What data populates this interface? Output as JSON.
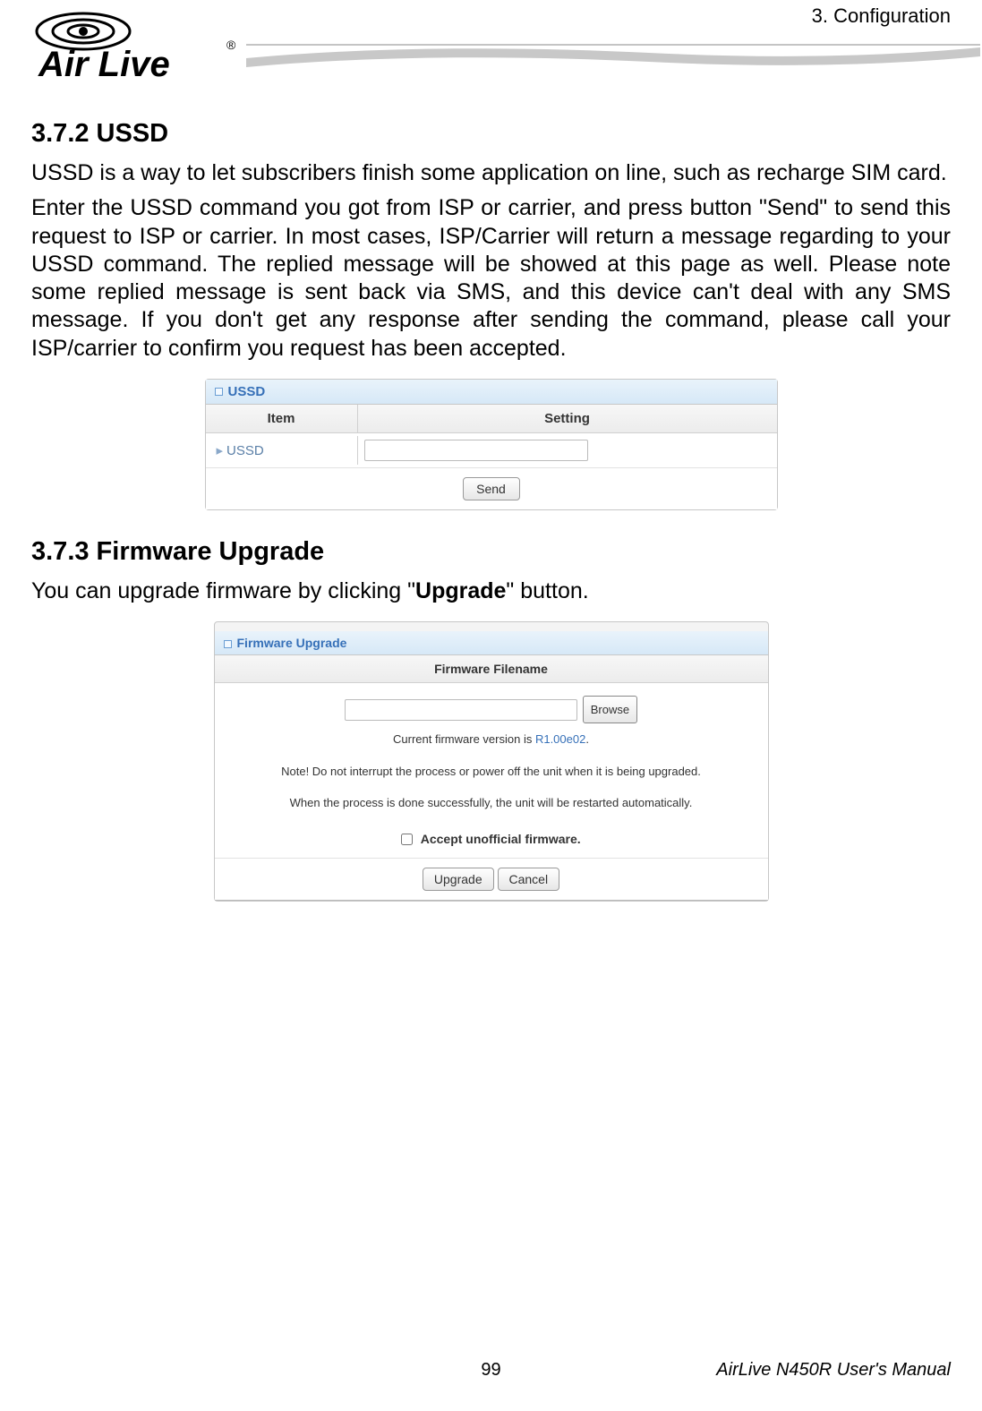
{
  "header": {
    "chapter": "3. Configuration",
    "logo_text_main": "Air Live",
    "logo_reg": "®"
  },
  "section1": {
    "heading": "3.7.2 USSD",
    "p1": "USSD is a way to let subscribers finish some application on line, such as recharge SIM card.",
    "p2": "Enter the USSD command you got from ISP or carrier, and press button \"Send\" to send this request to ISP or carrier. In most cases, ISP/Carrier will return a message regarding to your USSD command. The replied message will be showed at this page as well. Please note some replied message is sent back via SMS, and this device can't deal with any SMS message. If you don't get any response after sending the command, please call your ISP/carrier to confirm you request has been accepted."
  },
  "ussd": {
    "panel_title": "USSD",
    "col_item": "Item",
    "col_setting": "Setting",
    "row_label": "USSD",
    "send_btn": "Send"
  },
  "section2": {
    "heading": "3.7.3 Firmware Upgrade",
    "p1_pre": "You can upgrade firmware by clicking \"",
    "p1_bold": "Upgrade",
    "p1_post": "\" button."
  },
  "fw": {
    "panel_title": "Firmware Upgrade",
    "header": "Firmware Filename",
    "browse": "Browse",
    "ver_prefix": "Current firmware version is ",
    "ver_value": "R1.00e02",
    "ver_suffix": ".",
    "note1": "Note! Do not interrupt the process or power off the unit when it is being upgraded.",
    "note2": "When the process is done successfully, the unit will be restarted automatically.",
    "accept": "Accept unofficial firmware.",
    "upgrade_btn": "Upgrade",
    "cancel_btn": "Cancel"
  },
  "footer": {
    "page": "99",
    "doc": "AirLive N450R User's Manual"
  }
}
